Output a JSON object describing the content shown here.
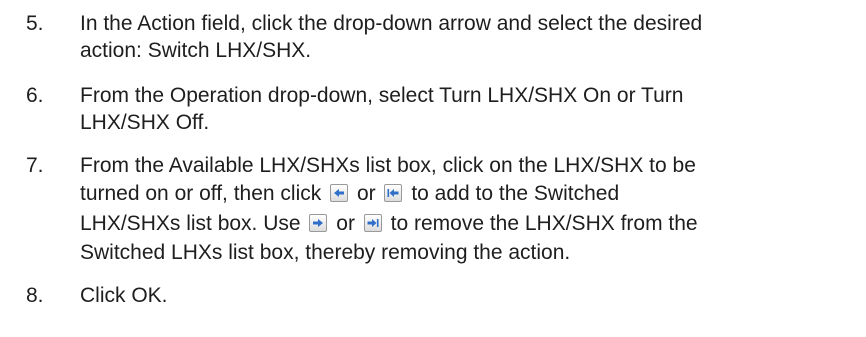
{
  "steps": [
    {
      "number": "5.",
      "lines": [
        "In the Action field, click the drop-down arrow and select the desired",
        "action: Switch LHX/SHX."
      ]
    },
    {
      "number": "6.",
      "lines": [
        "From the Operation drop-down, select Turn LHX/SHX On or Turn",
        "LHX/SHX Off."
      ]
    },
    {
      "number": "7.",
      "line1": "From the Available LHX/SHXs list box, click on the LHX/SHX to be",
      "line2_a": "turned on or off, then click",
      "line2_b": "or",
      "line2_c": "to add to the Switched",
      "line3_a": "LHX/SHXs list box. Use",
      "line3_b": "or",
      "line3_c": "to remove the LHX/SHX from the",
      "line4": "Switched LHXs list box, thereby removing the action.",
      "icons": [
        "add-one-icon",
        "add-all-icon",
        "remove-one-icon",
        "remove-all-icon"
      ]
    },
    {
      "number": "8.",
      "lines": [
        "Click OK."
      ]
    }
  ],
  "colors": {
    "text": "#1e1e1e",
    "icon_arrow": "#2f6fc9"
  }
}
